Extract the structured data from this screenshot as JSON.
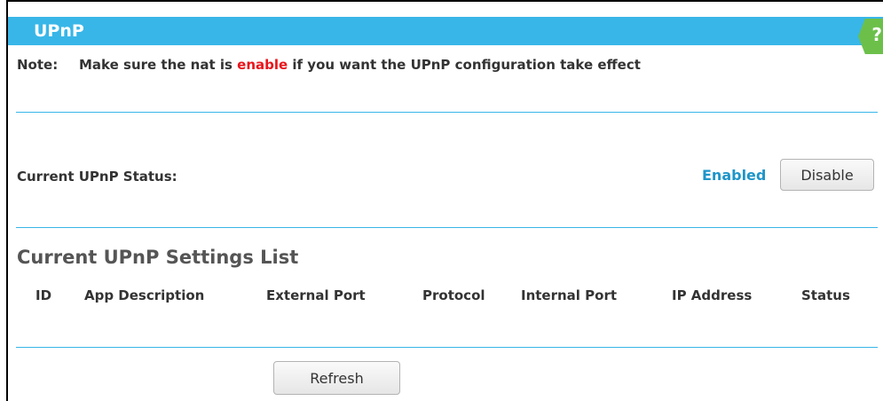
{
  "page": {
    "title": "UPnP",
    "help_icon": "question-mark-icon",
    "help_glyph": "?"
  },
  "note": {
    "label": "Note:",
    "text_before": "Make sure the nat is ",
    "highlight": "enable",
    "text_after": " if you want the UPnP configuration take effect"
  },
  "status": {
    "label": "Current UPnP Status:",
    "value": "Enabled",
    "toggle_button": "Disable"
  },
  "settings_list": {
    "heading": "Current UPnP Settings List",
    "columns": [
      "ID",
      "App Description",
      "External Port",
      "Protocol",
      "Internal Port",
      "IP Address",
      "Status"
    ],
    "rows": [],
    "refresh_button": "Refresh"
  },
  "colors": {
    "title_bar": "#38b6e8",
    "help_tab": "#6cc04a",
    "highlight_red": "#e8151b",
    "status_blue": "#1e95c9",
    "divider": "#38b6e8"
  }
}
